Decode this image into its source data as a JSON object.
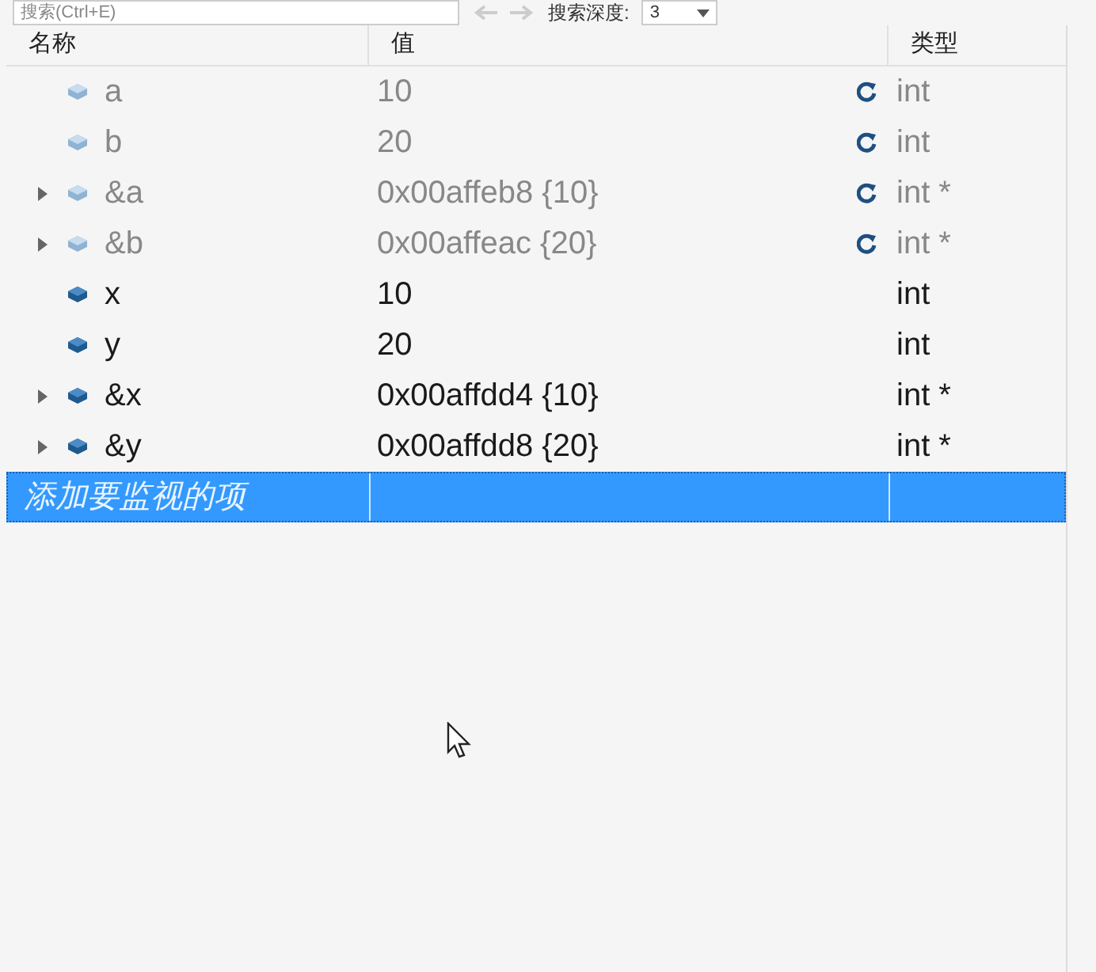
{
  "toolbar": {
    "search": {
      "placeholder": "搜索(Ctrl+E)"
    },
    "depth_label": "搜索深度:",
    "depth_value": "3"
  },
  "table": {
    "columns": [
      "名称",
      "值",
      "类型"
    ],
    "rows": [
      {
        "name": "a",
        "value": "10",
        "type": "int",
        "expandable": false,
        "stale": true
      },
      {
        "name": "b",
        "value": "20",
        "type": "int",
        "expandable": false,
        "stale": true
      },
      {
        "name": "&a",
        "value": "0x00affeb8 {10}",
        "type": "int *",
        "expandable": true,
        "stale": true
      },
      {
        "name": "&b",
        "value": "0x00affeac {20}",
        "type": "int *",
        "expandable": true,
        "stale": true
      },
      {
        "name": "x",
        "value": "10",
        "type": "int",
        "expandable": false,
        "stale": false
      },
      {
        "name": "y",
        "value": "20",
        "type": "int",
        "expandable": false,
        "stale": false
      },
      {
        "name": "&x",
        "value": "0x00affdd4 {10}",
        "type": "int *",
        "expandable": true,
        "stale": false
      },
      {
        "name": "&y",
        "value": "0x00affdd8 {20}",
        "type": "int *",
        "expandable": true,
        "stale": false
      }
    ],
    "add_row": {
      "placeholder": "添加要监视的项",
      "selected": true
    }
  }
}
